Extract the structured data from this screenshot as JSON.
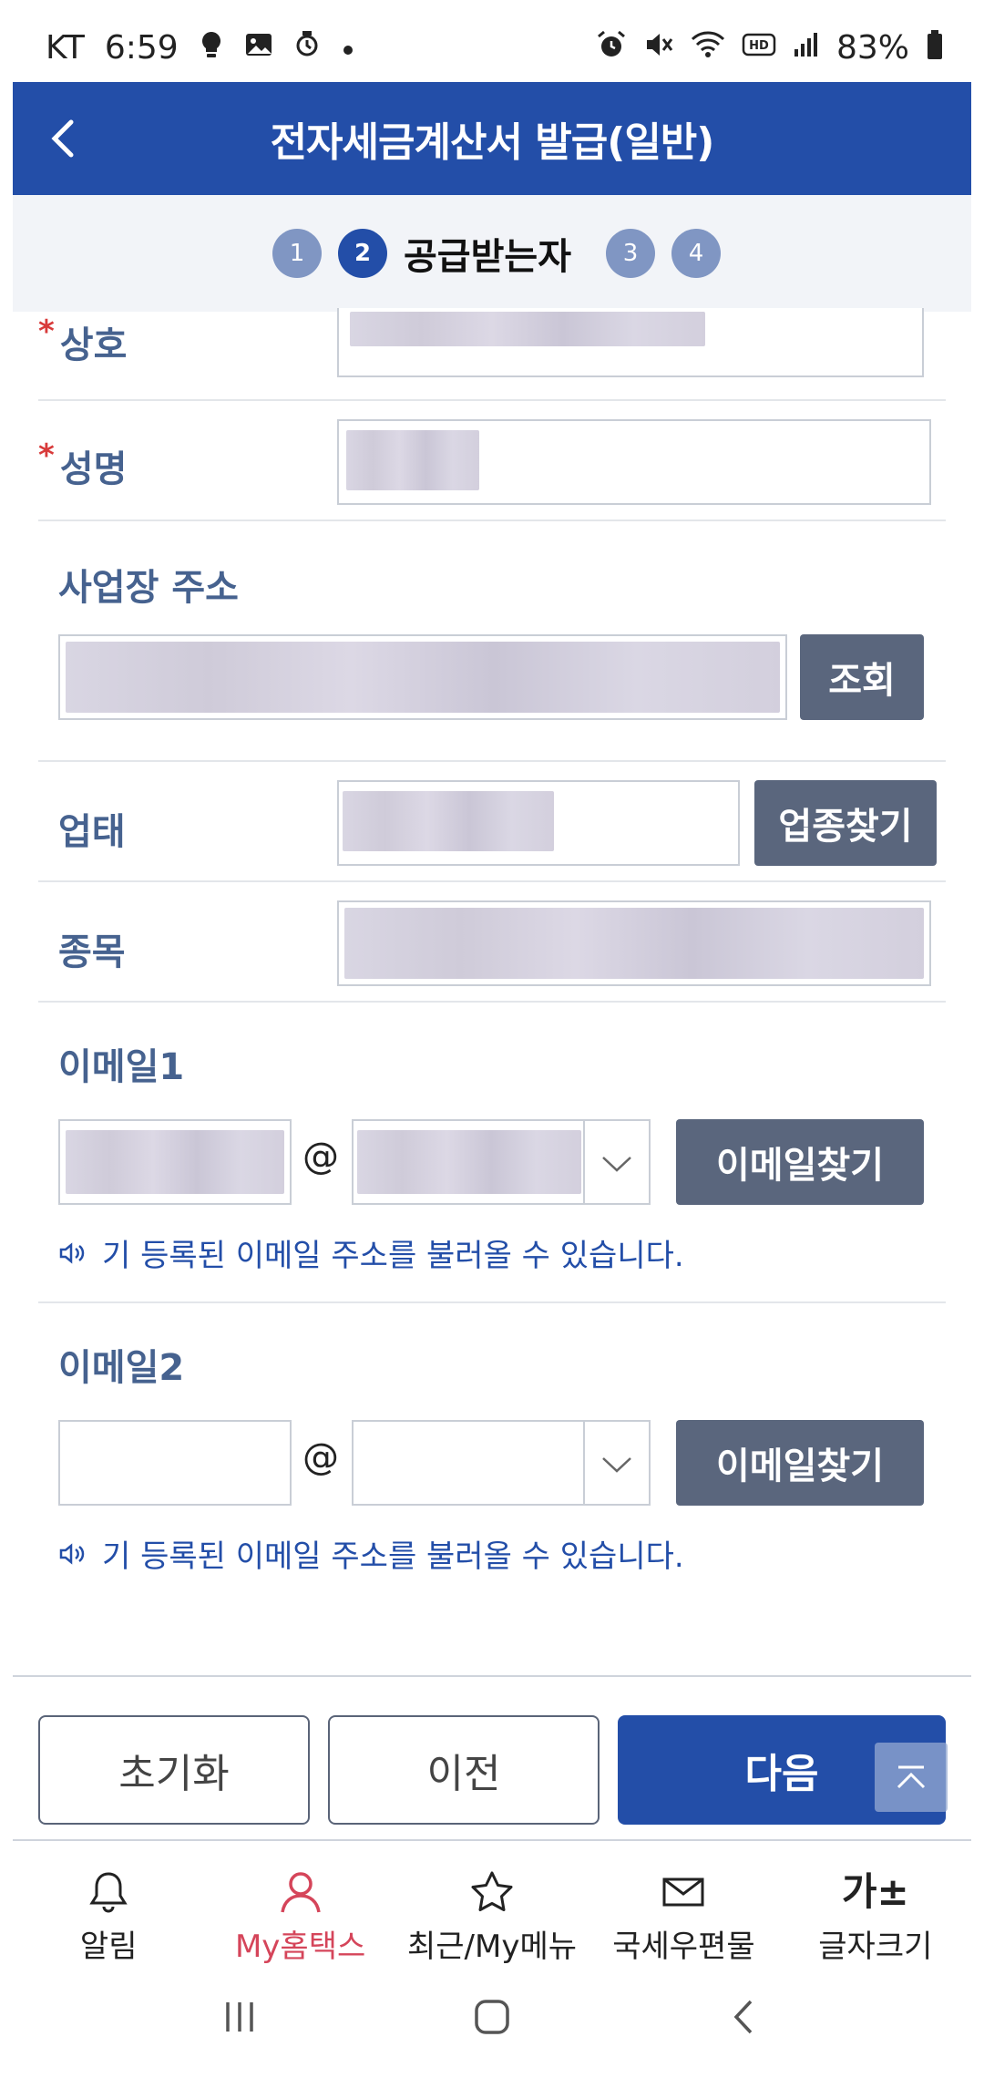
{
  "status_bar": {
    "carrier": "KT",
    "time": "6:59",
    "battery": "83%",
    "icons_left": [
      "bulb-icon",
      "image-icon",
      "watch-icon",
      "dot-icon"
    ],
    "icons_right": [
      "alarm-icon",
      "mute-icon",
      "wifi-icon",
      "hd-icon",
      "signal-icon",
      "battery-icon"
    ]
  },
  "header": {
    "title": "전자세금계산서 발급(일반)",
    "bg_color": "#234ea8"
  },
  "stepper": {
    "steps": [
      "1",
      "2",
      "3",
      "4"
    ],
    "active_index": 1,
    "active_label": "공급받는자"
  },
  "form": {
    "company": {
      "label": "상호",
      "required_mark": "*"
    },
    "name": {
      "label": "성명",
      "required_mark": "*"
    },
    "address": {
      "label": "사업장 주소",
      "lookup_button": "조회"
    },
    "business_type": {
      "label": "업태",
      "find_button": "업종찾기"
    },
    "business_item": {
      "label": "종목"
    },
    "email1": {
      "label": "이메일1",
      "at": "@",
      "find_button": "이메일찾기",
      "hint": "기 등록된 이메일 주소를 불러올 수 있습니다."
    },
    "email2": {
      "label": "이메일2",
      "at": "@",
      "find_button": "이메일찾기",
      "hint": "기 등록된 이메일 주소를 불러올 수 있습니다."
    }
  },
  "actions": {
    "reset": "초기화",
    "prev": "이전",
    "next": "다음"
  },
  "bottom_nav": {
    "items": [
      {
        "label": "알림",
        "icon": "bell-icon"
      },
      {
        "label": "My홈택스",
        "icon": "person-icon",
        "active": true
      },
      {
        "label": "최근/My메뉴",
        "icon": "star-icon"
      },
      {
        "label": "국세우편물",
        "icon": "mail-icon"
      },
      {
        "label": "글자크기",
        "icon": "font-size-icon",
        "icon_text": "가±"
      }
    ],
    "active_color": "#d5455a"
  }
}
